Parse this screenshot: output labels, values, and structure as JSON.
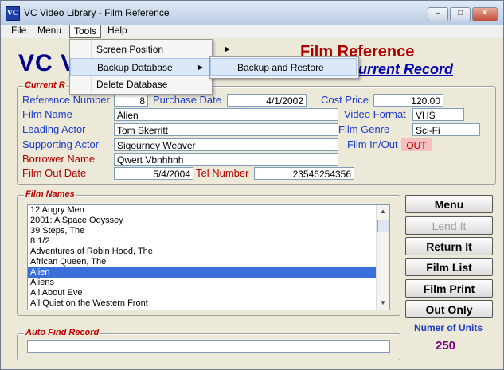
{
  "window": {
    "title": "VC Video Library - Film Reference",
    "icon_label": "VC"
  },
  "menubar": [
    "File",
    "Menu",
    "Tools",
    "Help"
  ],
  "tools_menu": {
    "items": [
      {
        "label": "Screen Position",
        "submenu": true
      },
      {
        "label": "Backup Database",
        "submenu": true
      },
      {
        "label": "Delete Database",
        "submenu": false
      }
    ],
    "backup_submenu": [
      "Backup and Restore"
    ]
  },
  "header": {
    "logo": "VC V",
    "title": "Film Reference",
    "subtitle": "Current Record"
  },
  "current_record": {
    "group_label": "Current R",
    "reference_number_label": "Reference Number",
    "reference_number": "8",
    "purchase_date_label": "Purchase Date",
    "purchase_date": "4/1/2002",
    "cost_price_label": "Cost Price",
    "cost_price": "120.00",
    "film_name_label": "Film Name",
    "film_name": "Alien",
    "video_format_label": "Video Format",
    "video_format": "VHS",
    "leading_actor_label": "Leading Actor",
    "leading_actor": "Tom Skerritt",
    "film_genre_label": "Film Genre",
    "film_genre": "Sci-Fi",
    "supporting_actor_label": "Supporting Actor",
    "supporting_actor": "Sigourney Weaver",
    "film_in_out_label": "Film In/Out",
    "film_in_out": "OUT",
    "borrower_name_label": "Borrower Name",
    "borrower_name": "Qwert Vbnhhhh",
    "film_out_date_label": "Film Out Date",
    "film_out_date": "5/4/2004",
    "tel_number_label": "Tel Number",
    "tel_number": "23546254356"
  },
  "film_names": {
    "group_label": "Film Names",
    "items": [
      "12 Angry Men",
      "2001: A Space Odyssey",
      "39 Steps, The",
      "8 1/2",
      "Adventures of Robin Hood, The",
      "African Queen, The",
      "Alien",
      "Aliens",
      "All About Eve",
      "All Quiet on the Western Front"
    ],
    "selected": "Alien"
  },
  "auto_find": {
    "group_label": "Auto Find Record",
    "value": ""
  },
  "buttons": {
    "menu": "Menu",
    "lend_it": "Lend It",
    "return_it": "Return It",
    "film_list": "Film List",
    "film_print": "Film Print",
    "out_only": "Out Only"
  },
  "units": {
    "label": "Numer of Units",
    "value": "250"
  }
}
